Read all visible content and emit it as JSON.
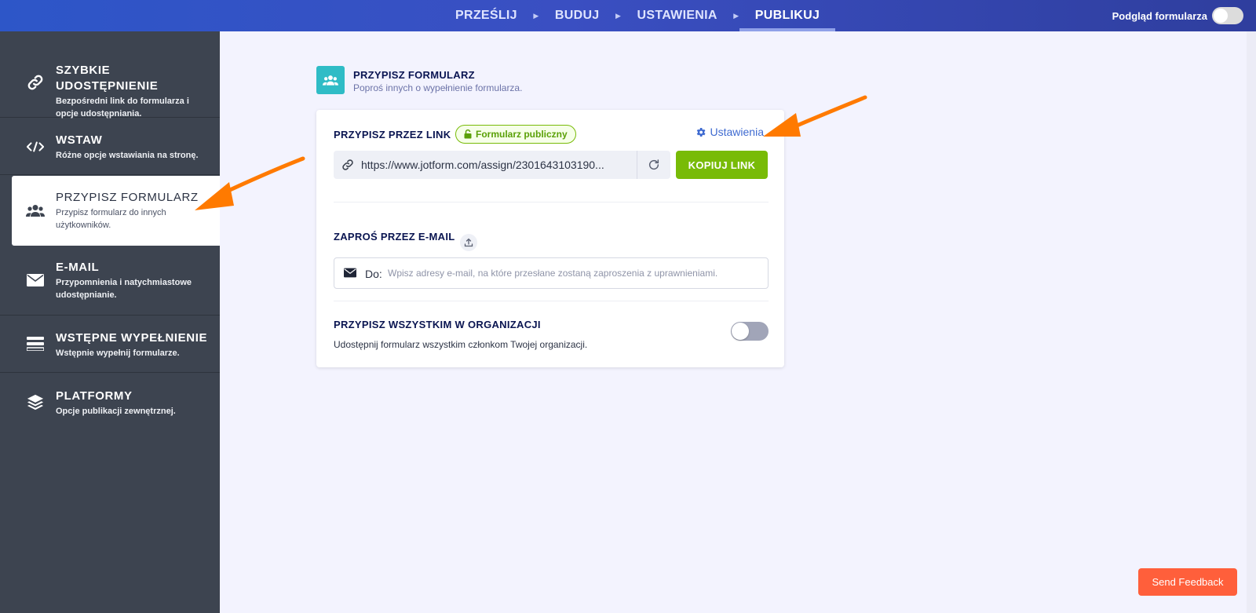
{
  "topbar": {
    "steps": [
      {
        "label": "PRZEŚLIJ"
      },
      {
        "label": "BUDUJ"
      },
      {
        "label": "USTAWIENIA"
      },
      {
        "label": "PUBLIKUJ"
      }
    ],
    "preview_label": "Podgląd formularza"
  },
  "sidebar": {
    "items": [
      {
        "title": "SZYBKIE UDOSTĘPNIENIE",
        "desc": "Bezpośredni link do formularza i opcje udostępniania.",
        "icon": "link-icon"
      },
      {
        "title": "WSTAW",
        "desc": "Różne opcje wstawiania na stronę.",
        "icon": "code-icon"
      },
      {
        "title": "PRZYPISZ FORMULARZ",
        "desc": "Przypisz formularz do innych użytkowników.",
        "icon": "users-icon"
      },
      {
        "title": "E-MAIL",
        "desc": "Przypomnienia i natychmiastowe udostępnianie.",
        "icon": "envelope-icon"
      },
      {
        "title": "WSTĘPNE WYPEŁNIENIE",
        "desc": "Wstępnie wypełnij formularze.",
        "icon": "prefill-icon"
      },
      {
        "title": "PLATFORMY",
        "desc": "Opcje publikacji zewnętrznej.",
        "icon": "layers-icon"
      }
    ]
  },
  "main": {
    "section_title": "PRZYPISZ FORMULARZ",
    "section_subtitle": "Poproś innych o wypełnienie formularza.",
    "link_label": "PRZYPISZ PRZEZ LINK",
    "badge": "Formularz publiczny",
    "settings": "Ustawienia",
    "link_url": "https://www.jotform.com/assign/2301643103190...",
    "copy_button": "KOPIUJ LINK",
    "email_label": "ZAPROŚ PRZEZ E-MAIL",
    "email_to": "Do:",
    "email_placeholder": "Wpisz adresy e-mail, na które przesłane zostaną zaproszenia z uprawnieniami.",
    "org_label": "PRZYPISZ WSZYSTKIM W ORGANIZACJI",
    "org_desc": "Udostępnij formularz wszystkim członkom Twojej organizacji.",
    "org_toggle_on": false
  },
  "feedback_button": "Send Feedback",
  "colors": {
    "accent_blue": "#2d56c8",
    "sidebar_bg": "#3d4450",
    "copy_green": "#78bb07",
    "feedback_orange": "#ff5f3b",
    "arrow_orange": "#ff7a00"
  }
}
